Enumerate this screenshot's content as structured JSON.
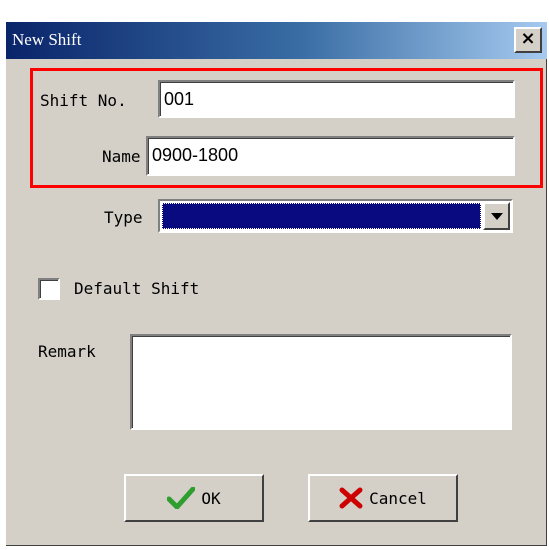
{
  "window": {
    "title": "New Shift",
    "close_symbol": "×"
  },
  "form": {
    "shift_no_label": "Shift No.",
    "shift_no_value": "001",
    "name_label": "Name",
    "name_value": "0900-1800",
    "type_label": "Type",
    "type_value": "",
    "default_shift_label": "Default Shift",
    "default_shift_checked": false,
    "remark_label": "Remark",
    "remark_value": ""
  },
  "buttons": {
    "ok_label": "OK",
    "cancel_label": "Cancel"
  },
  "icons": {
    "ok": "checkmark-icon",
    "cancel": "x-mark-icon",
    "dropdown": "chevron-down-icon",
    "close": "close-icon"
  },
  "colors": {
    "title_bar": "#0a246a",
    "highlight": "#ff0000",
    "ok_icon": "#2e9e2e",
    "cancel_icon": "#cc0000",
    "type_selection": "#0a0a80"
  }
}
